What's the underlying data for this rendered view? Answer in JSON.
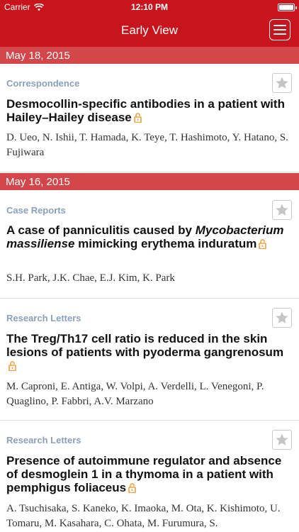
{
  "status": {
    "carrier": "Carrier",
    "time": "12:10 PM",
    "battery_level": 1.0
  },
  "nav": {
    "title": "Early View"
  },
  "sections": [
    {
      "date": "May 18, 2015",
      "articles": [
        {
          "category": "Correspondence",
          "title": "Desmocollin-specific antibodies in a patient with Hailey–Hailey disease",
          "authors": "D. Ueo, N. Ishii, T. Hamada, K. Teye, T. Hashimoto, Y. Hatano, S. Fujiwara"
        }
      ]
    },
    {
      "date": "May 16, 2015",
      "articles": [
        {
          "category": "Case Reports",
          "title_pre": "A case of panniculitis caused by",
          "title_italic": "Mycobacterium massiliense",
          "title_post": "mimicking erythema induratum",
          "authors": "S.H. Park, J.K. Chae, E.J. Kim, K. Park"
        },
        {
          "category": "Research Letters",
          "title": "The Treg/Th17 cell ratio is reduced in the skin lesions of patients with pyoderma gangrenosum",
          "authors": "M. Caproni, E. Antiga, W. Volpi, A. Verdelli, L. Venegoni, P. Quaglino, P. Fabbri, A.V. Marzano"
        },
        {
          "category": "Research Letters",
          "title": "Presence of autoimmune regulator and absence of desmoglein 1 in a thymoma in a patient with pemphigus foliaceus",
          "authors": "A. Tsuchisaka, S. Kaneko, K. Imaoka, M. Ota, K. Kishimoto, U. Tomaru, M. Kasahara, C. Ohata, M. Furumura, S."
        }
      ]
    }
  ],
  "colors": {
    "brand": "#c8141c",
    "section_header": "#d3474a",
    "category": "#8aa0bb",
    "open_access": "#f0a040"
  }
}
